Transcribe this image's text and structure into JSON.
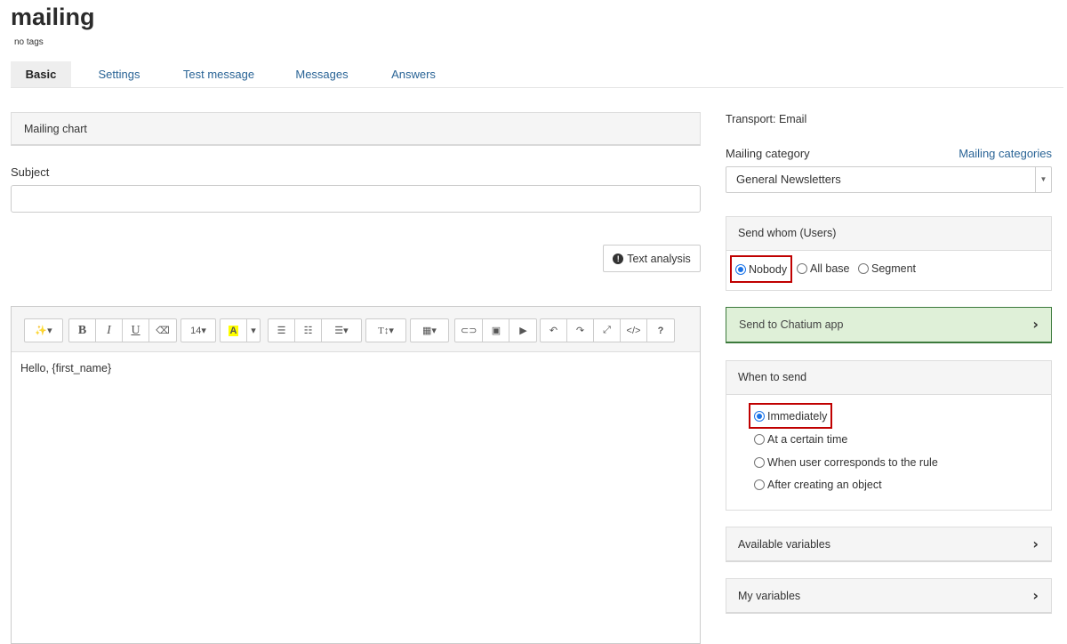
{
  "page": {
    "title": "mailing",
    "tags": "no tags"
  },
  "tabs": [
    {
      "label": "Basic",
      "active": true
    },
    {
      "label": "Settings",
      "active": false
    },
    {
      "label": "Test message",
      "active": false
    },
    {
      "label": "Messages",
      "active": false
    },
    {
      "label": "Answers",
      "active": false
    }
  ],
  "left": {
    "chart_panel": "Mailing chart",
    "subject_label": "Subject",
    "subject_value": "",
    "text_analysis_label": "Text analysis",
    "text_analysis_icon": "!",
    "editor_body": "Hello, {first_name}"
  },
  "toolbar": {
    "magic_icon": "✨▾",
    "bold": "B",
    "italic": "I",
    "underline": "U",
    "eraser_icon": "⌫",
    "font_size": "14▾",
    "highlight": "A",
    "color_dropdown": "▾",
    "bullet_list_icon": "☰",
    "numbered_list_icon": "☷",
    "align_icon": "☰▾",
    "text_height_icon": "T↕▾",
    "table_icon": "▦▾",
    "link_icon": "⊂⊃",
    "image_icon": "▣",
    "video_icon": "▶",
    "undo_icon": "↶",
    "redo_icon": "↷",
    "fullscreen_icon": "⤢",
    "code_icon": "</>",
    "help_icon": "?"
  },
  "right": {
    "transport": "Transport: Email",
    "category_label": "Mailing category",
    "category_link": "Mailing categories",
    "category_selected": "General Newsletters",
    "select_arrow": "▼",
    "send_whom": {
      "title": "Send whom (Users)",
      "options": [
        {
          "label": "Nobody",
          "checked": true
        },
        {
          "label": "All base",
          "checked": false
        },
        {
          "label": "Segment",
          "checked": false
        }
      ]
    },
    "chatium": "Send to Chatium app",
    "when_to_send": {
      "title": "When to send",
      "options": [
        {
          "label": "Immediately",
          "checked": true
        },
        {
          "label": "At a certain time",
          "checked": false
        },
        {
          "label": "When user corresponds to the rule",
          "checked": false
        },
        {
          "label": "After creating an object",
          "checked": false
        }
      ]
    },
    "available_variables": "Available variables",
    "my_variables": "My variables",
    "chevron": "›"
  },
  "colors": {
    "link": "#2a6496",
    "highlight_border": "#c00000",
    "chatium_bg": "#dff0d8",
    "chatium_border": "#3c7a3c",
    "radio_checked": "#1a73e8"
  }
}
